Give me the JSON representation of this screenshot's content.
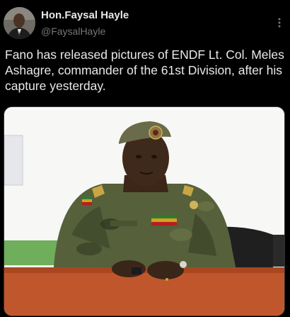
{
  "author": {
    "display_name": "Hon.Faysal Hayle",
    "handle": "@FaysalHayle",
    "avatar_icon": "profile-photo"
  },
  "tweet": {
    "text": "Fano has released pictures of ENDF Lt. Col. Meles Ashagre, commander of the 61st Division, after his capture yesterday."
  },
  "menu": {
    "icon": "more-vertical-icon"
  },
  "media": {
    "description_icon": "photo-attachment"
  },
  "colors": {
    "background": "#000000",
    "text_primary": "#e7e9ea",
    "text_secondary": "#71767b",
    "divider": "#2f3336"
  }
}
